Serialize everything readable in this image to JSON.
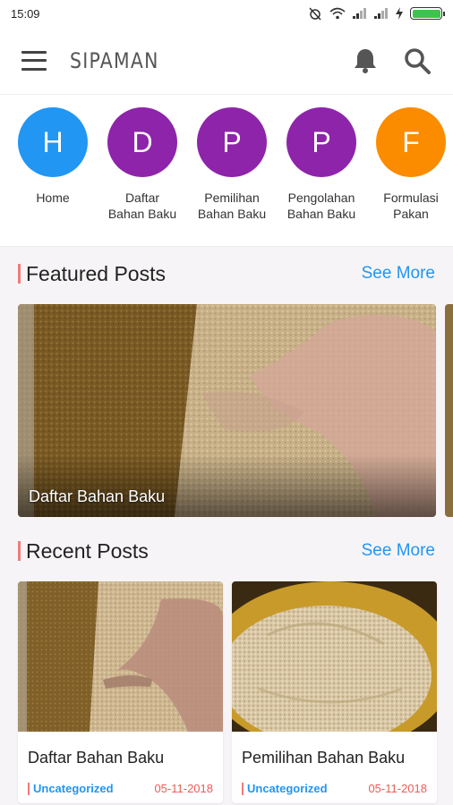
{
  "status_bar": {
    "time": "15:09"
  },
  "app_bar": {
    "title": "SIPAMAN"
  },
  "categories": [
    {
      "letter": "H",
      "label": "Home",
      "color": "#2196f3"
    },
    {
      "letter": "D",
      "label": "Daftar Bahan Baku",
      "color": "#8e24aa"
    },
    {
      "letter": "P",
      "label": "Pemilihan Bahan Baku",
      "color": "#8e24aa"
    },
    {
      "letter": "P",
      "label": "Pengolahan Bahan Baku",
      "color": "#8e24aa"
    },
    {
      "letter": "F",
      "label": "Formulasi Pakan",
      "color": "#fb8c00"
    }
  ],
  "featured": {
    "title": "Featured Posts",
    "see_more": "See More",
    "items": [
      {
        "caption": "Daftar Bahan Baku"
      }
    ]
  },
  "recent": {
    "title": "Recent Posts",
    "see_more": "See More",
    "items": [
      {
        "title": "Daftar Bahan Baku",
        "category": "Uncategorized",
        "date": "05-11-2018"
      },
      {
        "title": "Pemilihan Bahan Baku",
        "category": "Uncategorized",
        "date": "05-11-2018"
      }
    ]
  },
  "colors": {
    "accent": "#2196f3",
    "marker": "#f07a7a",
    "date": "#f05a5a"
  }
}
